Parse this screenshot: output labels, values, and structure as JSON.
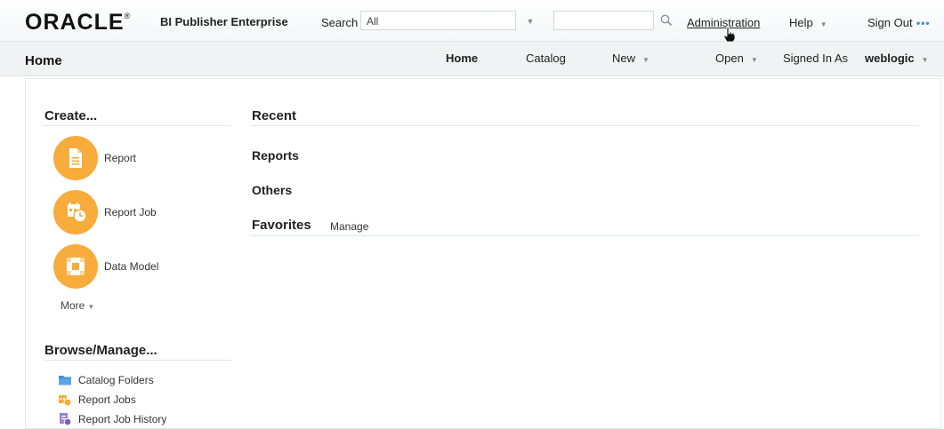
{
  "header": {
    "logo_text": "ORACLE",
    "logo_mark": "®",
    "product": "BI Publisher Enterprise",
    "search_label": "Search",
    "search_scope": "All",
    "search_value": "",
    "administration": "Administration",
    "help": "Help",
    "sign_out": "Sign Out",
    "more_dots": "•••"
  },
  "navbar": {
    "page_title": "Home",
    "home": "Home",
    "catalog": "Catalog",
    "new": "New",
    "open": "Open",
    "signed_in_as": "Signed In As",
    "username": "weblogic"
  },
  "create": {
    "title": "Create...",
    "items": [
      {
        "label": "Report",
        "icon": "report-icon"
      },
      {
        "label": "Report Job",
        "icon": "report-job-icon"
      },
      {
        "label": "Data Model",
        "icon": "data-model-icon"
      }
    ],
    "more": "More"
  },
  "browse": {
    "title": "Browse/Manage...",
    "items": [
      {
        "label": "Catalog Folders",
        "icon": "folder-icon"
      },
      {
        "label": "Report Jobs",
        "icon": "report-jobs-icon"
      },
      {
        "label": "Report Job History",
        "icon": "job-history-icon"
      }
    ]
  },
  "recent": {
    "title": "Recent",
    "reports": "Reports",
    "others": "Others"
  },
  "favorites": {
    "title": "Favorites",
    "manage": "Manage"
  },
  "colors": {
    "accent_orange": "#f7ac3b",
    "link_blue": "#3b8fd9"
  }
}
